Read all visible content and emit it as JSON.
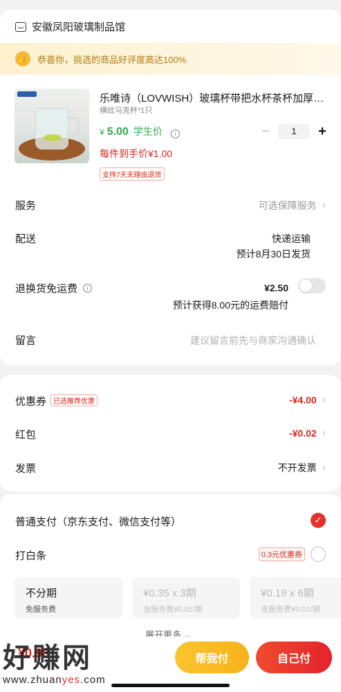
{
  "shop": {
    "name": "安徽凤阳玻璃制品馆",
    "icon": "store-icon"
  },
  "notice": {
    "text": "恭喜你，挑选的商品好评度高达100%",
    "icon": "thumbs-up-icon"
  },
  "product": {
    "title": "乐唯诗（LOVWISH）玻璃杯带把水杯茶杯加厚耐热家用",
    "spec": "横纹马克杯*1只",
    "price_currency": "¥",
    "price": "5.00",
    "price_tag": "学生价",
    "final_price": "每件到手价¥1.00",
    "return_badge": "支持7天无理由退货",
    "quantity": "1",
    "minus": "−",
    "plus": "+"
  },
  "rows": {
    "service": {
      "label": "服务",
      "value": "可选保障服务"
    },
    "delivery": {
      "label": "配送",
      "value": "快递运输",
      "sub": "预计8月30日发货"
    },
    "return_fee": {
      "label": "退换货免运费",
      "value": "¥2.50",
      "sub": "预计获得8.00元的运费赔付"
    },
    "message": {
      "label": "留言",
      "placeholder": "建议留言前先与商家沟通确认"
    }
  },
  "discounts": {
    "coupon": {
      "label": "优惠券",
      "badge": "已选推荐优惠",
      "value": "-¥4.00"
    },
    "red_packet": {
      "label": "红包",
      "value": "-¥0.02"
    },
    "invoice": {
      "label": "发票",
      "value": "不开发票"
    }
  },
  "payment": {
    "normal": {
      "label": "普通支付（京东支付、微信支付等）",
      "selected": true
    },
    "baitiao": {
      "label": "打白条",
      "promo": "0.3元优惠券",
      "selected": false
    },
    "installments": [
      {
        "title": "不分期",
        "sub": "免服务费",
        "enabled": true
      },
      {
        "title": "¥0.35 x 3期",
        "sub": "含服务费¥0.01/期",
        "enabled": false
      },
      {
        "title": "¥0.19 x 6期",
        "sub": "含服务费¥0.01/期",
        "enabled": false
      }
    ],
    "expand": "展开更多"
  },
  "bottom": {
    "total": "¥0.98",
    "help_pay": "帮我付",
    "self_pay": "自己付"
  },
  "watermark": {
    "main": "好赚网",
    "url_prefix": "www.zhuan",
    "url_mid": "yes",
    "url_suffix": ".com"
  },
  "colors": {
    "accent_red": "#e4312b",
    "accent_yellow": "#f7b21c",
    "student_green": "#33a852"
  }
}
